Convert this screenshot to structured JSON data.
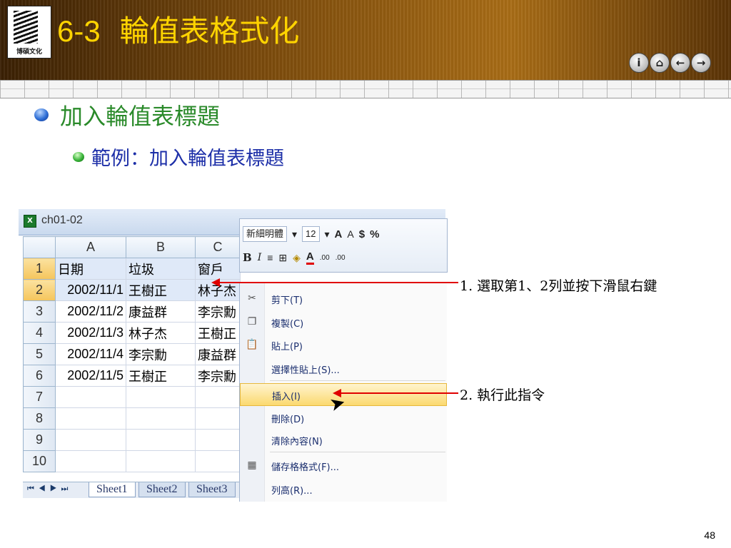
{
  "slide": {
    "title_num": "6-3",
    "title_text": "輪值表格式化",
    "logo_text": "博碩文化",
    "bullet1": "加入輪值表標題",
    "bullet2": "範例：加入輪值表標題",
    "page_number": "48",
    "nav_icons": [
      "info-icon",
      "home-icon",
      "back-icon",
      "forward-icon"
    ]
  },
  "excel": {
    "window_title": "ch01-02",
    "columns": [
      "A",
      "B",
      "C"
    ],
    "rows": [
      {
        "num": "1",
        "a": "日期",
        "b": "垃圾",
        "c": "窗戶"
      },
      {
        "num": "2",
        "a": "2002/11/1",
        "b": "王樹正",
        "c": "林子杰"
      },
      {
        "num": "3",
        "a": "2002/11/2",
        "b": "康益群",
        "c": "李宗勳"
      },
      {
        "num": "4",
        "a": "2002/11/3",
        "b": "林子杰",
        "c": "王樹正"
      },
      {
        "num": "5",
        "a": "2002/11/4",
        "b": "李宗勳",
        "c": "康益群"
      },
      {
        "num": "6",
        "a": "2002/11/5",
        "b": "王樹正",
        "c": "李宗勳"
      },
      {
        "num": "7",
        "a": "",
        "b": "",
        "c": ""
      },
      {
        "num": "8",
        "a": "",
        "b": "",
        "c": ""
      },
      {
        "num": "9",
        "a": "",
        "b": "",
        "c": ""
      },
      {
        "num": "10",
        "a": "",
        "b": "",
        "c": ""
      }
    ],
    "sheet_tabs": [
      "Sheet1",
      "Sheet2",
      "Sheet3"
    ],
    "active_tab": "Sheet1"
  },
  "mini_toolbar": {
    "font_name": "新細明體",
    "font_size": "12",
    "grow_font": "A",
    "shrink_font": "A",
    "currency": "$",
    "percent": "%",
    "bold": "B",
    "italic": "I",
    "font_color": "A",
    "increase_decimal": ".00",
    "decrease_decimal": ".00"
  },
  "context_menu": {
    "items": [
      {
        "label": "剪下(T)",
        "icon": "scissors-icon"
      },
      {
        "label": "複製(C)",
        "icon": "copy-icon"
      },
      {
        "label": "貼上(P)",
        "icon": "paste-icon"
      },
      {
        "label": "選擇性貼上(S)...",
        "icon": ""
      },
      {
        "label": "插入(I)",
        "icon": "",
        "highlighted": true
      },
      {
        "label": "刪除(D)",
        "icon": ""
      },
      {
        "label": "清除內容(N)",
        "icon": ""
      },
      {
        "label": "儲存格格式(F)...",
        "icon": "format-cells-icon"
      },
      {
        "label": "列高(R)...",
        "icon": ""
      }
    ]
  },
  "annotations": {
    "note1": "1. 選取第1、2列並按下滑鼠右鍵",
    "note2": "2. 執行此指令",
    "arrow_color": "#e00000"
  }
}
